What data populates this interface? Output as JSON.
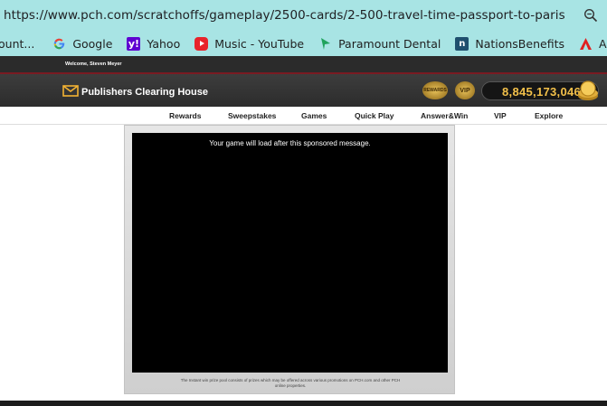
{
  "browser": {
    "url": "https://www.pch.com/scratchoffs/gameplay/2500-cards/2-500-travel-time-passport-to-paris"
  },
  "bookmarks": [
    {
      "label": "ount...",
      "icon": "account-icon"
    },
    {
      "label": "Google",
      "icon": "google-icon"
    },
    {
      "label": "Yahoo",
      "icon": "yahoo-icon"
    },
    {
      "label": "Music - YouTube",
      "icon": "youtube-icon"
    },
    {
      "label": "Paramount Dental",
      "icon": "paramount-dental-icon"
    },
    {
      "label": "NationsBenefits",
      "icon": "nationsbenefits-icon"
    },
    {
      "label": "AARP® Offi",
      "icon": "aarp-icon"
    }
  ],
  "site": {
    "welcome": "Welcome, Steven Meyer",
    "brand": "Publishers Clearing House",
    "badge_rewards": "REWARDS",
    "badge_vip": "VIP",
    "token_balance": "8,845,173,046"
  },
  "nav": [
    "Rewards",
    "Sweepstakes",
    "Games",
    "Quick Play",
    "Answer&Win",
    "VIP",
    "Explore"
  ],
  "game": {
    "message": "Your game will load after this sponsored message.",
    "disclaimer": "The Instant win prize pool consists of prizes which may be offered across various promotions on PCH.com and other PCH online properties."
  },
  "colors": {
    "browser_chrome": "#a8e4e4",
    "header_dark": "#2b2b2b",
    "token_gold": "#f2c04a"
  }
}
